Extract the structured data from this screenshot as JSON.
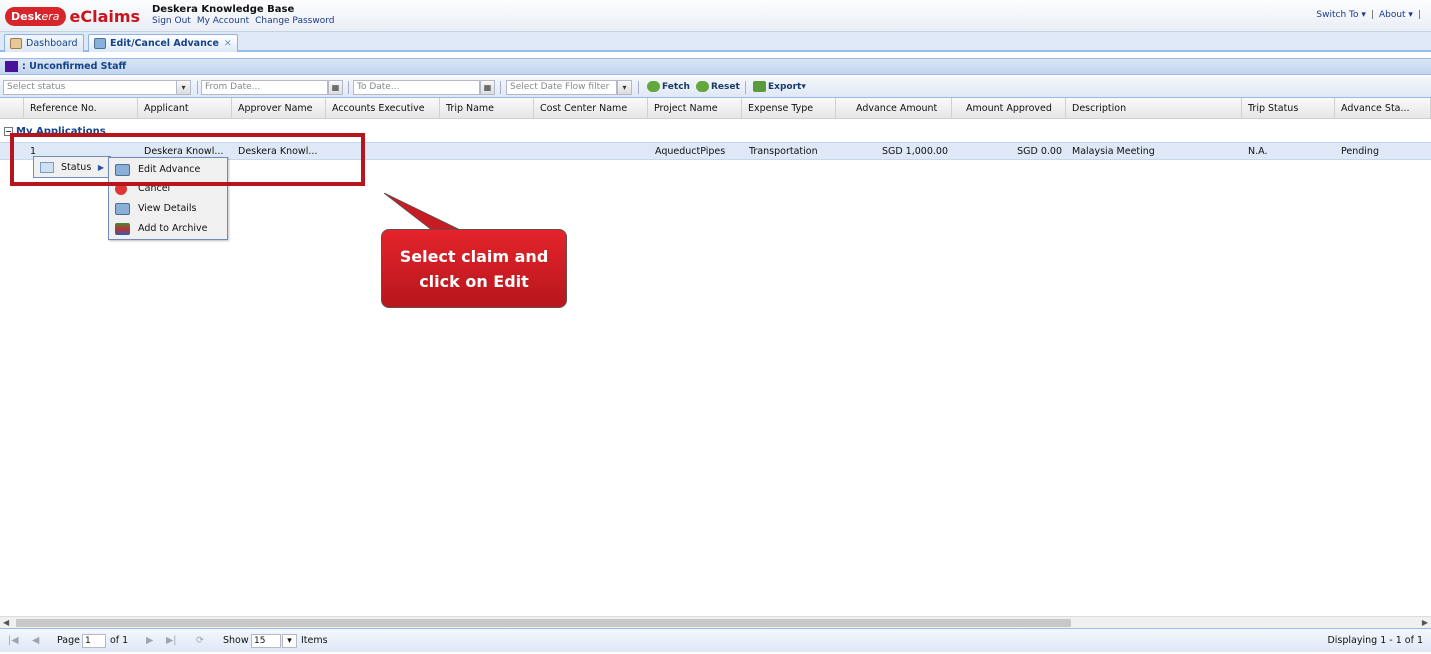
{
  "header": {
    "logo_prefix": "Desk",
    "logo_suffix": "era",
    "app_name": "eClaims",
    "kb_title": "Deskera Knowledge Base",
    "links": [
      "Sign Out",
      "My Account",
      "Change Password"
    ],
    "switch_to": "Switch To ▾",
    "about": "About ▾",
    "sep": "|"
  },
  "tabs": [
    {
      "label": "Dashboard",
      "icon": "dashboard-icon"
    },
    {
      "label": "Edit/Cancel Advance",
      "icon": "edit-advance-icon",
      "close": "✕"
    }
  ],
  "panel": {
    "title": ": Unconfirmed Staff"
  },
  "toolbar": {
    "status_placeholder": "Select status",
    "from_date_placeholder": "From Date...",
    "to_date_placeholder": "To Date...",
    "date_flow_placeholder": "Select Date Flow filter",
    "fetch": "Fetch",
    "reset": "Reset",
    "export": "Export▾"
  },
  "grid": {
    "columns": [
      "Reference No.",
      "Applicant",
      "Approver Name",
      "Accounts Executive",
      "Trip Name",
      "Cost Center Name",
      "Project Name",
      "Expense Type",
      "Advance Amount",
      "Amount Approved",
      "Description",
      "Trip Status",
      "Advance Sta..."
    ],
    "group_label": "My Applications",
    "row": {
      "ref": "1",
      "applicant": "Deskera Knowl...",
      "approver": "Deskera Knowl...",
      "project": "AqueductPipes",
      "expense_type": "Transportation",
      "advance_amount": "SGD 1,000.00",
      "amount_approved": "SGD 0.00",
      "description": "Malaysia Meeting",
      "trip_status": "N.A.",
      "advance_status": "Pending"
    }
  },
  "context_menu": {
    "status": "Status",
    "items": [
      "Edit Advance",
      "Cancel",
      "View Details",
      "Add to Archive"
    ]
  },
  "callout": {
    "text": "Select claim and click on Edit"
  },
  "pager": {
    "page_label": "Page",
    "page_value": "1",
    "of_label": "of 1",
    "show_label": "Show",
    "show_value": "15",
    "items_label": "Items",
    "displaying": "Displaying 1 - 1 of 1"
  }
}
